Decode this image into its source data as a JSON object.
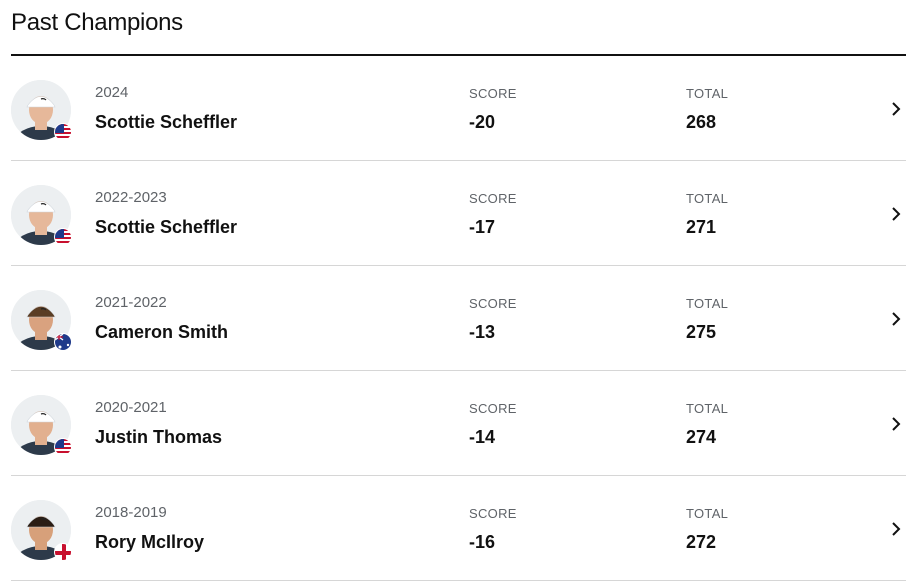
{
  "page": {
    "title": "Past Champions"
  },
  "labels": {
    "score": "SCORE",
    "total": "TOTAL"
  },
  "champions": [
    {
      "year": "2024",
      "name": "Scottie Scheffler",
      "score": "-20",
      "total": "268",
      "flag": "usa-flag-icon",
      "skin": "#e6b89a",
      "hair": "#ffffff"
    },
    {
      "year": "2022-2023",
      "name": "Scottie Scheffler",
      "score": "-17",
      "total": "271",
      "flag": "usa-flag-icon",
      "skin": "#e6b89a",
      "hair": "#ffffff"
    },
    {
      "year": "2021-2022",
      "name": "Cameron Smith",
      "score": "-13",
      "total": "275",
      "flag": "australia-flag-icon",
      "skin": "#d9a27f",
      "hair": "#5a3d24"
    },
    {
      "year": "2020-2021",
      "name": "Justin Thomas",
      "score": "-14",
      "total": "274",
      "flag": "usa-flag-icon",
      "skin": "#e2b08f",
      "hair": "#ffffff"
    },
    {
      "year": "2018-2019",
      "name": "Rory McIlroy",
      "score": "-16",
      "total": "272",
      "flag": "northern-ireland-flag-icon",
      "skin": "#d7a07a",
      "hair": "#2b1d14"
    }
  ],
  "colors": {
    "accent": "#111111",
    "divider": "#d6d6d6",
    "muted": "#5f6368"
  }
}
